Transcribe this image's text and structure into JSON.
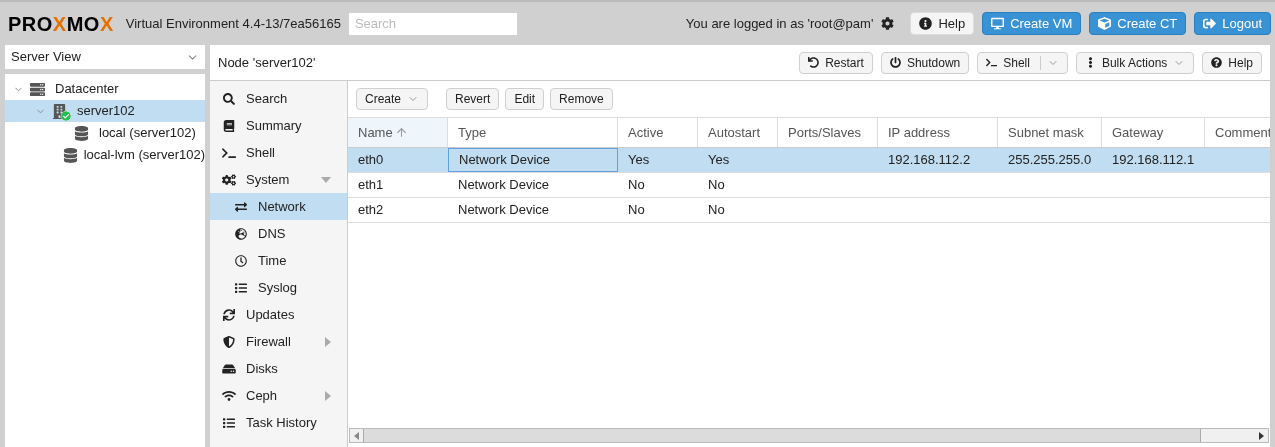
{
  "header": {
    "logo": [
      {
        "text": "PRO",
        "color": "#000000"
      },
      {
        "text": "X",
        "color": "#e57000"
      },
      {
        "text": "MO",
        "color": "#000000"
      },
      {
        "text": "X",
        "color": "#e57000"
      }
    ],
    "version": "Virtual Environment 4.4-13/7ea56165",
    "search": {
      "placeholder": "Search"
    },
    "login": "You are logged in as 'root@pam'",
    "buttons": [
      {
        "label": "Help",
        "kind": "plain"
      },
      {
        "label": "Create VM",
        "kind": "primary"
      },
      {
        "label": "Create CT",
        "kind": "primary"
      },
      {
        "label": "Logout",
        "kind": "primary"
      }
    ]
  },
  "view_selector": {
    "value": "Server View"
  },
  "tree": [
    {
      "label": "Datacenter",
      "kind": "datacenter",
      "selected": false,
      "expanded": true,
      "children": [
        {
          "label": "server102",
          "kind": "node",
          "selected": true,
          "expanded": true,
          "children": [
            {
              "label": "local (server102)",
              "kind": "storage",
              "selected": false
            },
            {
              "label": "local-lvm (server102)",
              "kind": "storage",
              "selected": false
            }
          ]
        }
      ]
    }
  ],
  "content": {
    "title": "Node 'server102'",
    "toolbar": [
      {
        "label": "Restart",
        "kind": "plain"
      },
      {
        "label": "Shutdown",
        "kind": "plain"
      },
      {
        "label": "Shell",
        "kind": "split"
      },
      {
        "label": "Bulk Actions",
        "kind": "menu"
      },
      {
        "label": "Help",
        "kind": "plain"
      }
    ],
    "nav": [
      {
        "label": "Search",
        "selected": false
      },
      {
        "label": "Summary",
        "selected": false
      },
      {
        "label": "Shell",
        "selected": false
      },
      {
        "label": "System",
        "selected": false,
        "expanded": true,
        "children": [
          {
            "label": "Network",
            "selected": true
          },
          {
            "label": "DNS",
            "selected": false
          },
          {
            "label": "Time",
            "selected": false
          },
          {
            "label": "Syslog",
            "selected": false
          }
        ]
      },
      {
        "label": "Updates",
        "selected": false
      },
      {
        "label": "Firewall",
        "selected": false,
        "expanded": false
      },
      {
        "label": "Disks",
        "selected": false
      },
      {
        "label": "Ceph",
        "selected": false,
        "expanded": false
      },
      {
        "label": "Task History",
        "selected": false
      }
    ],
    "grid_toolbar": [
      {
        "label": "Create",
        "kind": "menu"
      },
      {
        "label": "Revert",
        "kind": "plain"
      },
      {
        "label": "Edit",
        "kind": "plain"
      },
      {
        "label": "Remove",
        "kind": "plain"
      }
    ],
    "table": {
      "columns": [
        {
          "label": "Name",
          "sorted": true
        },
        {
          "label": "Type",
          "sorted": false
        },
        {
          "label": "Active",
          "sorted": false
        },
        {
          "label": "Autostart",
          "sorted": false
        },
        {
          "label": "Ports/Slaves",
          "sorted": false
        },
        {
          "label": "IP address",
          "sorted": false
        },
        {
          "label": "Subnet mask",
          "sorted": false
        },
        {
          "label": "Gateway",
          "sorted": false
        },
        {
          "label": "Comment",
          "sorted": false
        }
      ],
      "rows": [
        {
          "selected": true,
          "cells": [
            "eth0",
            "Network Device",
            "Yes",
            "Yes",
            "",
            "192.168.112.2",
            "255.255.255.0",
            "192.168.112.1",
            ""
          ]
        },
        {
          "selected": false,
          "cells": [
            "eth1",
            "Network Device",
            "No",
            "No",
            "",
            "",
            "",
            "",
            ""
          ]
        },
        {
          "selected": false,
          "cells": [
            "eth2",
            "Network Device",
            "No",
            "No",
            "",
            "",
            "",
            "",
            ""
          ]
        }
      ]
    }
  }
}
